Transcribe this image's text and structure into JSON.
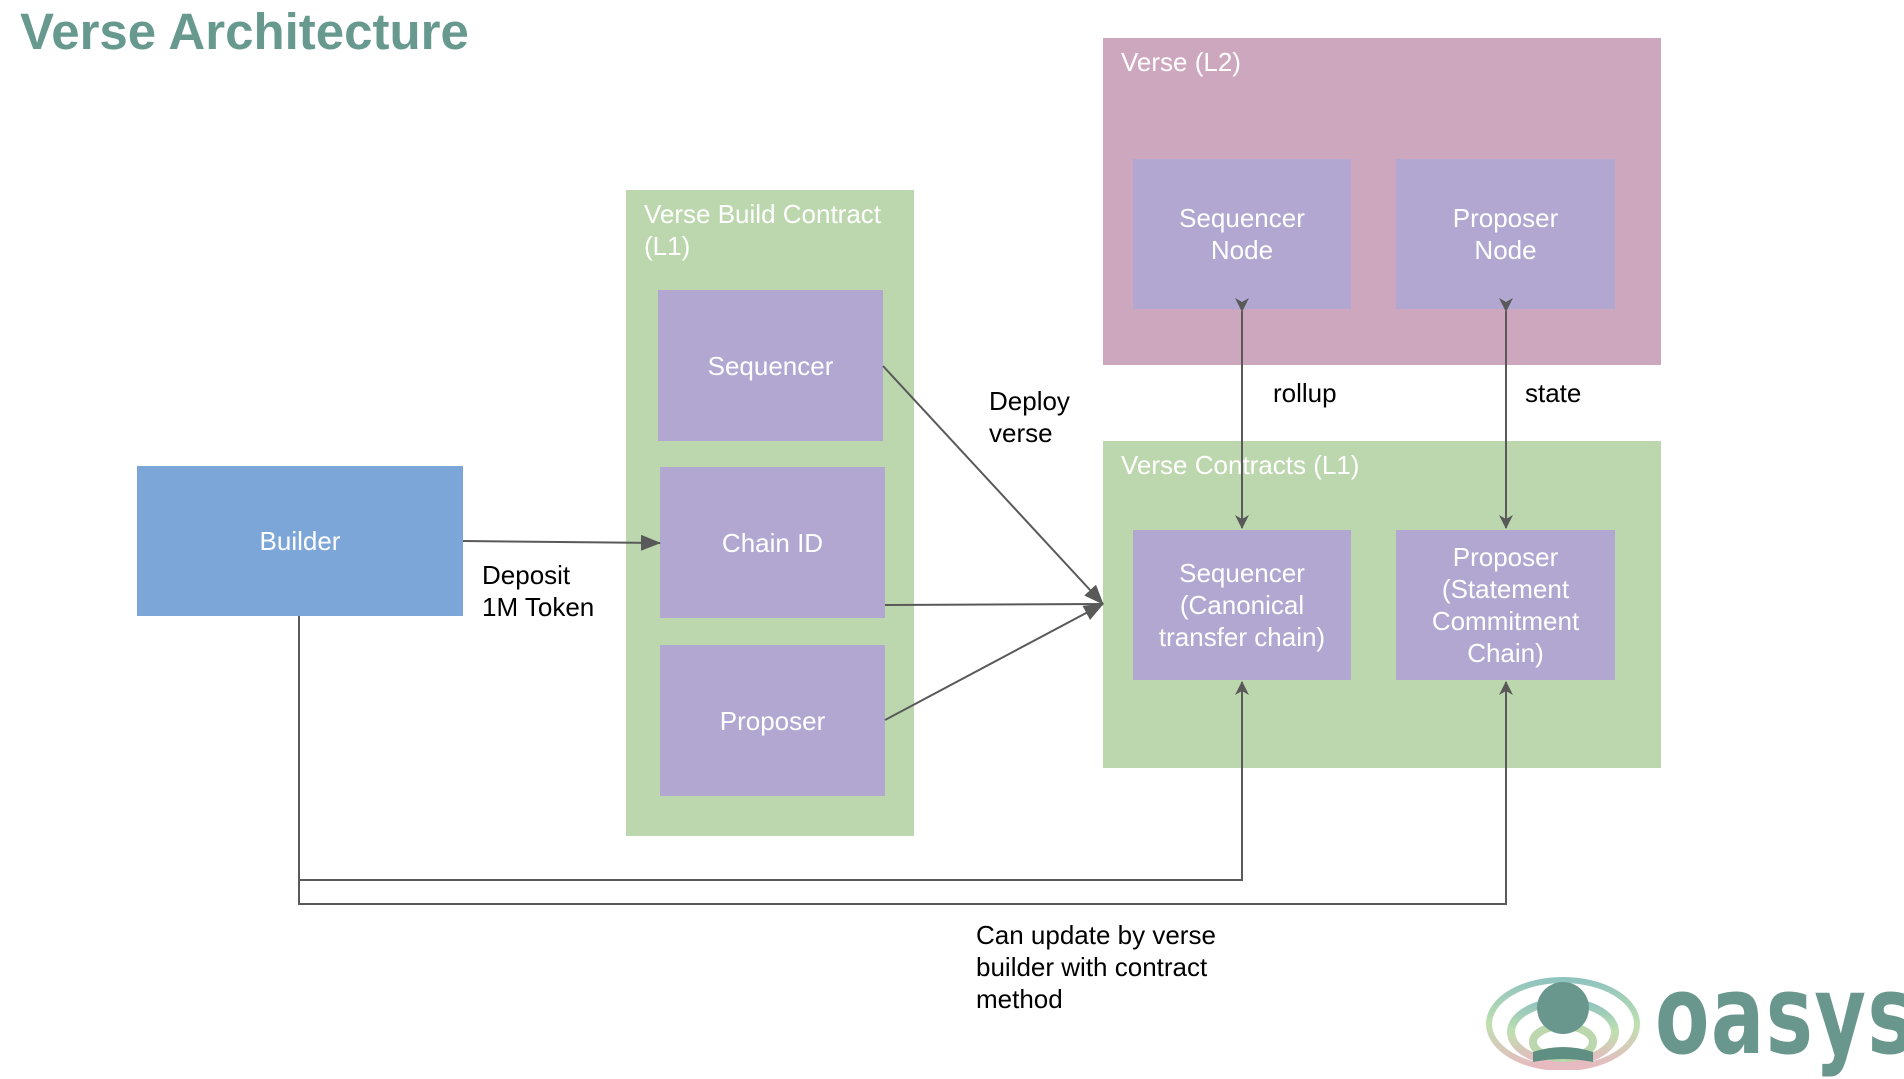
{
  "title": "Verse Architecture",
  "nodes": {
    "builder": "Builder",
    "build_contract": {
      "label": "Verse Build Contract\n(L1)",
      "sequencer": "Sequencer",
      "chain_id": "Chain ID",
      "proposer": "Proposer"
    },
    "verse_l2": {
      "label": "Verse (L2)",
      "sequencer_node": "Sequencer\nNode",
      "proposer_node": "Proposer\nNode"
    },
    "verse_contracts": {
      "label": "Verse Contracts (L1)",
      "sequencer": "Sequencer\n(Canonical\ntransfer chain)",
      "proposer": "Proposer\n(Statement\nCommitment\nChain)"
    }
  },
  "edge_labels": {
    "deposit": "Deposit\n1M Token",
    "deploy": "Deploy\nverse",
    "rollup": "rollup",
    "state": "state",
    "update": "Can update by verse\nbuilder with contract\nmethod"
  },
  "logo": {
    "wordmark": "oasys"
  },
  "colors": {
    "title": "#67998f",
    "builder": "#7ca6d7",
    "contract_container": "#bcd7ad",
    "l2_container": "#cda7bd",
    "component": "#b1a7d1",
    "edge": "#595959"
  }
}
